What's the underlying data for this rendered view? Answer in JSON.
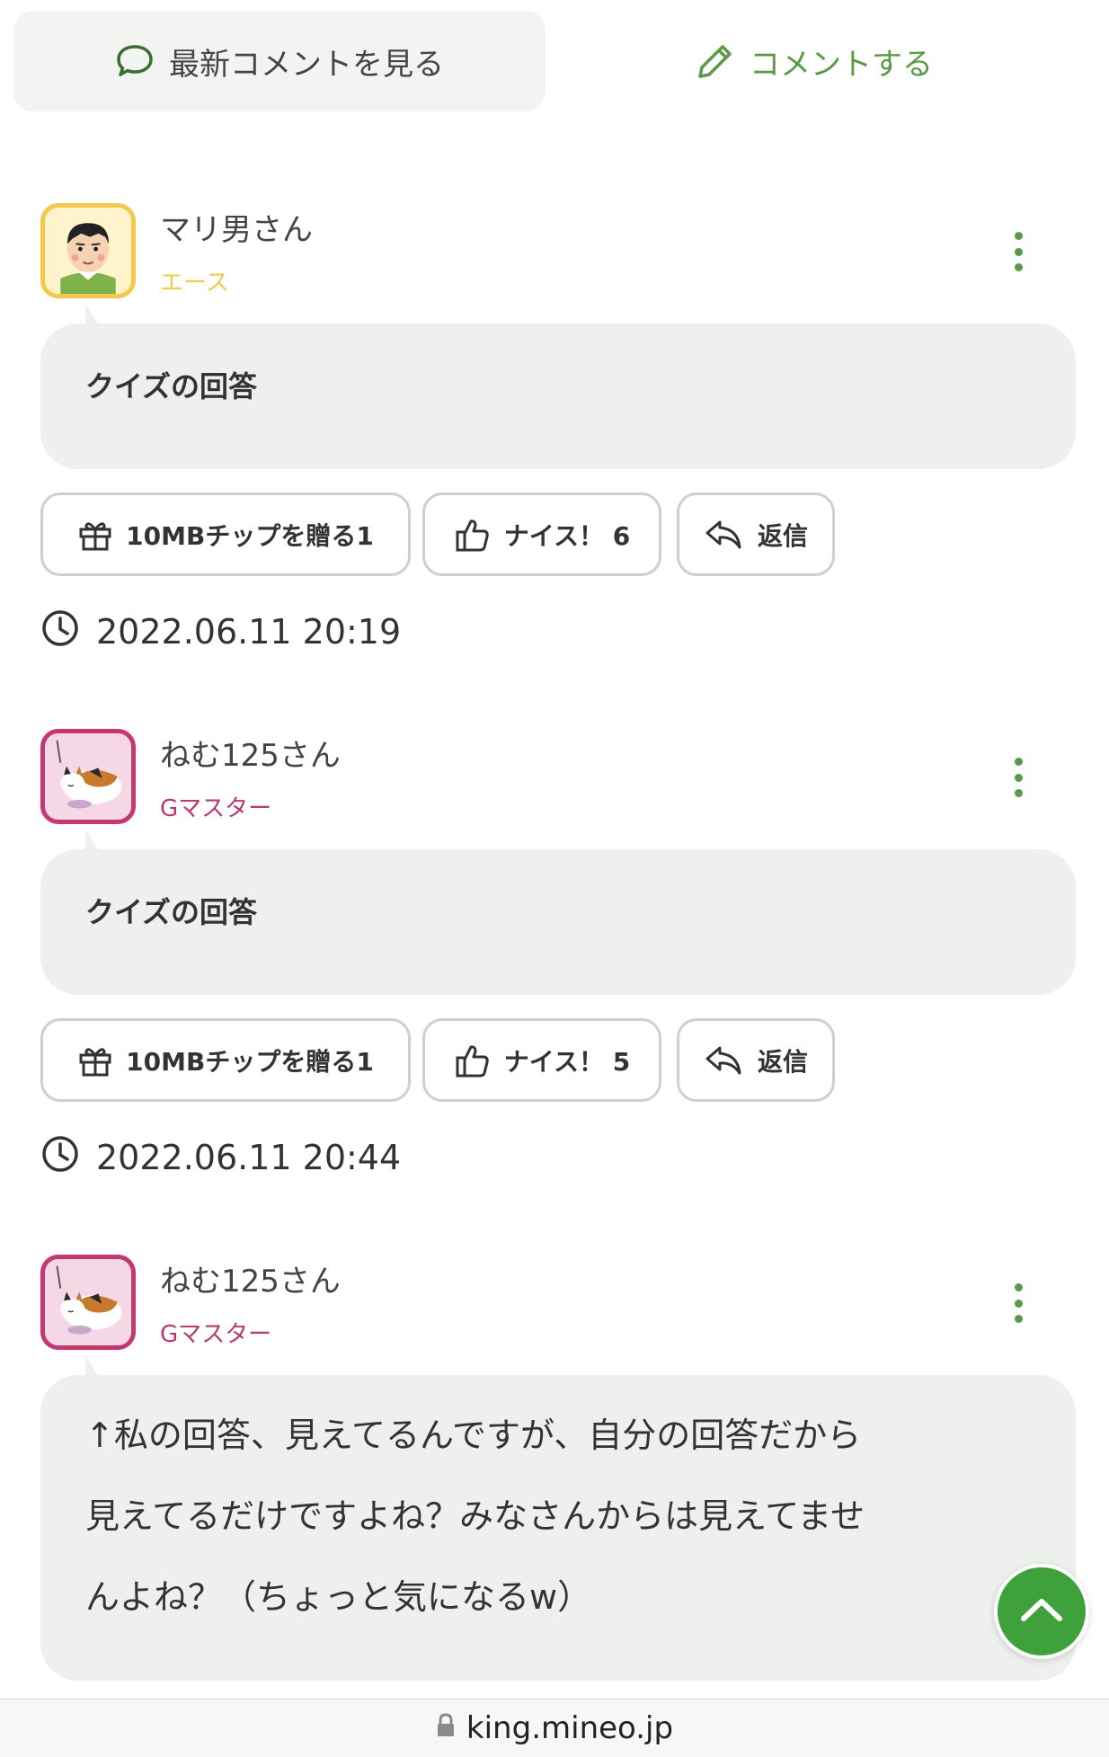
{
  "tabs": {
    "latest_label": "最新コメントを見る",
    "comment_label": "コメントする"
  },
  "comments": [
    {
      "user": "マリ男さん",
      "rank": "エース",
      "title": "クイズの回答",
      "tip_label": "10MBチップを贈る1",
      "nice_label": "ナイス！ 6",
      "reply_label": "返信",
      "timestamp": "2022.06.11 20:19"
    },
    {
      "user": "ねむ125さん",
      "rank": "Gマスター",
      "title": "クイズの回答",
      "tip_label": "10MBチップを贈る1",
      "nice_label": "ナイス！ 5",
      "reply_label": "返信",
      "timestamp": "2022.06.11 20:44"
    },
    {
      "user": "ねむ125さん",
      "rank": "Gマスター",
      "text": "↑私の回答、見えてるんですが、自分の回答だから\n見えてるだけですよね？みなさんからは見えてませ\nんよね？（ちょっと気になるw）"
    }
  ],
  "browser": {
    "url": "king.mineo.jp"
  },
  "colors": {
    "accent_green": "#5a9a46",
    "scroll_button": "#3fa13c",
    "ace_rank": "#f2c94c",
    "gmaster_rank": "#b63a6e",
    "bubble_bg": "#edf0ed"
  }
}
